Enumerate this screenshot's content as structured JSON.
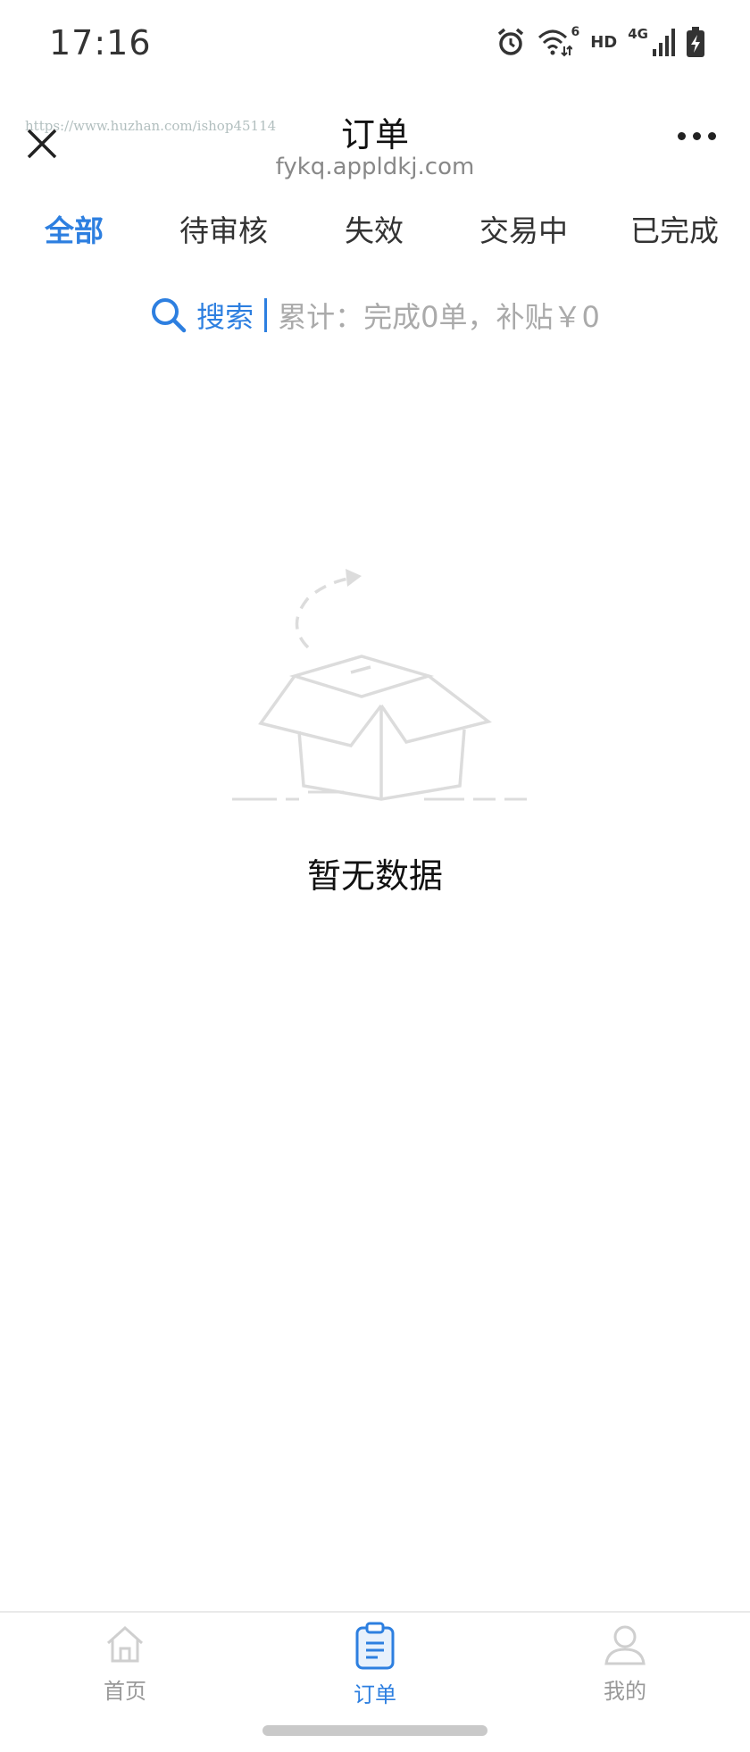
{
  "status_bar": {
    "time": "17:16",
    "wifi_badge": "6",
    "hd_label": "HD",
    "network_label": "4G",
    "icons": [
      "alarm-icon",
      "wifi-icon",
      "signal-icon",
      "battery-charging-icon"
    ]
  },
  "header": {
    "watermark": "https://www.huzhan.com/ishop45114",
    "title": "订单",
    "domain": "fykq.appldkj.com"
  },
  "tabs": [
    {
      "label": "全部",
      "active": true
    },
    {
      "label": "待审核",
      "active": false
    },
    {
      "label": "失效",
      "active": false
    },
    {
      "label": "交易中",
      "active": false
    },
    {
      "label": "已完成",
      "active": false
    }
  ],
  "search": {
    "label": "搜索",
    "totals": "累计：完成0单，补贴￥0"
  },
  "empty_state": {
    "message": "暂无数据"
  },
  "bottom_nav": [
    {
      "label": "首页",
      "icon": "home-icon",
      "active": false
    },
    {
      "label": "订单",
      "icon": "clipboard-icon",
      "active": true
    },
    {
      "label": "我的",
      "icon": "user-icon",
      "active": false
    }
  ],
  "colors": {
    "accent": "#2d7fe0",
    "muted_text": "#999999",
    "illustration": "#dddddd"
  }
}
